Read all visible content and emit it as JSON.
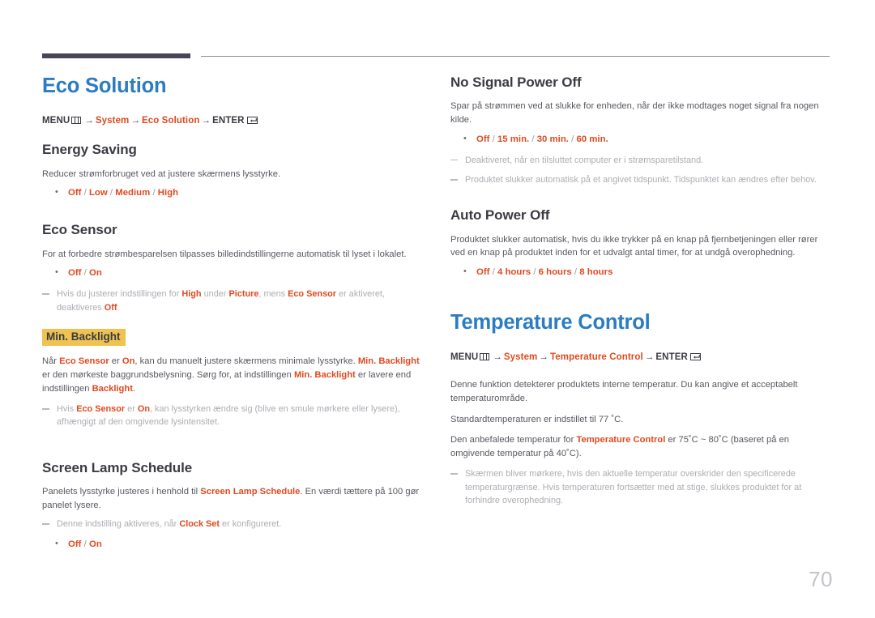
{
  "page": {
    "number": "70",
    "accent_blue": "#2b7cc1",
    "accent_orange": "#e0491f",
    "highlight_yellow": "#eec351",
    "rule_dark": "#46455c"
  },
  "left_column": {
    "chapter_title": "Eco Solution",
    "menu_path": {
      "menu_label": "MENU",
      "arrow": "→",
      "step1": "System",
      "step2": "Eco Solution",
      "enter_label": "ENTER"
    },
    "sections": [
      {
        "heading": "Energy Saving",
        "body": "Reducer strømforbruget ved at justere skærmens lysstyrke.",
        "options": [
          "Off",
          "Low",
          "Medium",
          "High"
        ]
      },
      {
        "heading": "Eco Sensor",
        "body": "For at forbedre strømbesparelsen tilpasses billedindstillingerne automatisk til lyset i lokalet.",
        "options": [
          "Off",
          "On"
        ],
        "note": {
          "p1": "Hvis du justerer indstillingen for ",
          "b1": "High",
          "p2": " under ",
          "b2": "Picture",
          "p3": ", mens ",
          "b3": "Eco Sensor",
          "p4": " er aktiveret, deaktiveres ",
          "b4": "Off",
          "p5": "."
        }
      }
    ],
    "min_backlight": {
      "heading": "Min. Backlight",
      "para": {
        "t1": "Når ",
        "h1": "Eco Sensor",
        "t2": " er ",
        "h2": "On",
        "t3": ", kan du manuelt justere skærmens minimale lysstyrke. ",
        "h3": "Min. Backlight",
        "t4": " er den mørkeste baggrundsbelysning. Sørg for, at indstillingen ",
        "h4": "Min. Backlight",
        "t5": " er lavere end indstillingen ",
        "h5": "Backlight",
        "t6": "."
      },
      "note": {
        "p1": "Hvis ",
        "b1": "Eco Sensor",
        "p2": " er ",
        "b2": "On",
        "p3": ", kan lysstyrken ændre sig (blive en smule mørkere eller lysere), afhængigt af den omgivende lysintensitet."
      }
    },
    "screen_lamp_schedule": {
      "heading": "Screen Lamp Schedule",
      "para": {
        "t1": "Panelets lysstyrke justeres i henhold til ",
        "h1": "Screen Lamp Schedule",
        "t2": ". En værdi tættere på 100 gør panelet lysere."
      },
      "note": {
        "p1": "Denne indstilling aktiveres, når ",
        "b1": "Clock Set",
        "p2": " er konfigureret."
      },
      "options": [
        "Off",
        "On"
      ]
    }
  },
  "right_column": {
    "no_signal_power_off": {
      "heading": "No Signal Power Off",
      "body": "Spar på strømmen ved at slukke for enheden, når der ikke modtages noget signal fra nogen kilde.",
      "options": [
        "Off",
        "15 min.",
        "30 min.",
        "60 min."
      ],
      "note1": "Deaktiveret, når en tilsluttet computer er i strømsparetilstand.",
      "note2": "Produktet slukker automatisk på et angivet tidspunkt. Tidspunktet kan ændres efter behov."
    },
    "auto_power_off": {
      "heading": "Auto Power Off",
      "body": "Produktet slukker automatisk, hvis du ikke trykker på en knap på fjernbetjeningen eller rører ved en knap på produktet inden for et udvalgt antal timer, for at undgå overophedning.",
      "options": [
        "Off",
        "4 hours",
        "6 hours",
        "8 hours"
      ]
    },
    "chapter_title": "Temperature Control",
    "menu_path": {
      "menu_label": "MENU",
      "arrow": "→",
      "step1": "System",
      "step2": "Temperature Control",
      "enter_label": "ENTER"
    },
    "temperature_control": {
      "body1": "Denne funktion detekterer produktets interne temperatur. Du kan angive et acceptabelt temperaturområde.",
      "body2": "Standardtemperaturen er indstillet til 77 ˚C.",
      "body3": {
        "t1": "Den anbefalede temperatur for ",
        "h1": "Temperature Control",
        "t2": " er 75˚C ~ 80˚C (baseret på en omgivende temperatur på 40˚C)."
      },
      "note": "Skærmen bliver mørkere, hvis den aktuelle temperatur overskrider den specificerede temperaturgrænse. Hvis temperaturen fortsætter med at stige, slukkes produktet for at forhindre overophedning."
    }
  }
}
